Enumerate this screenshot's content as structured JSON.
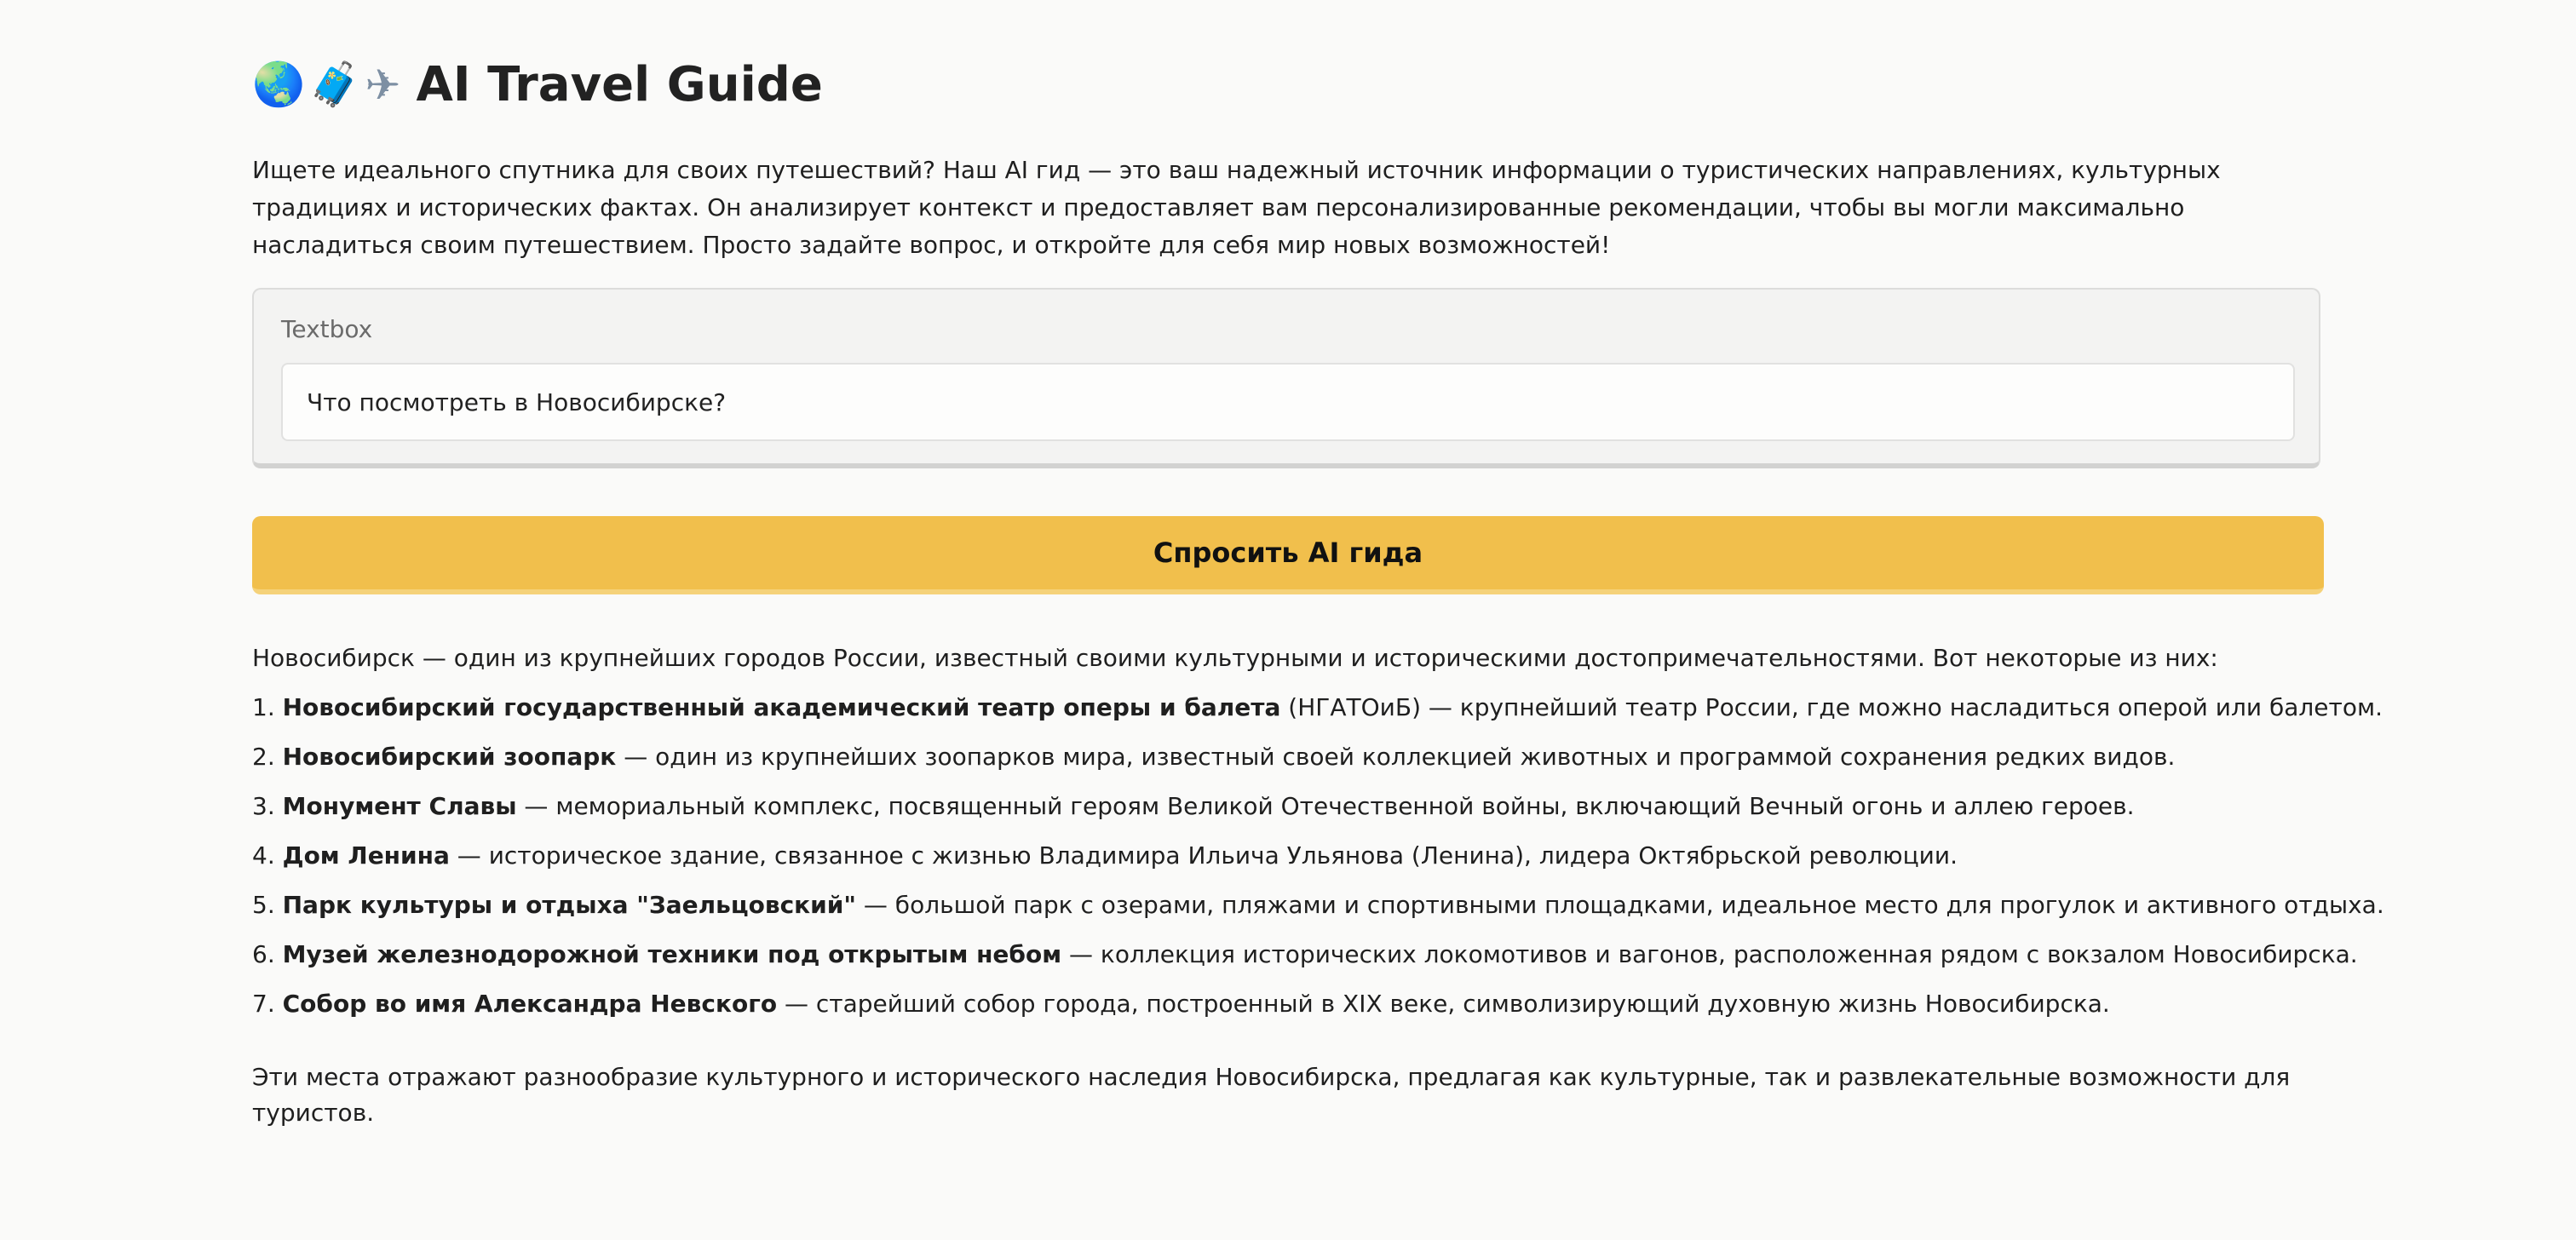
{
  "header": {
    "emoji_globe": "🌏",
    "emoji_luggage": "🧳",
    "emoji_plane": "✈",
    "title": "AI Travel Guide"
  },
  "intro": "Ищете идеального спутника для своих путешествий? Наш AI гид — это ваш надежный источник информации о туристических направлениях, культурных традициях и исторических фактах. Он анализирует контекст и предоставляет вам персонализированные рекомендации, чтобы вы могли максимально насладиться своим путешествием. Просто задайте вопрос, и откройте для себя мир новых возможностей!",
  "textbox": {
    "label": "Textbox",
    "value": "Что посмотреть в Новосибирске?"
  },
  "ask_button": {
    "label": "Спросить AI гида",
    "color": "#f1bf4c"
  },
  "answer": {
    "lead": "Новосибирск — один из крупнейших городов России, известный своими культурными и историческими достопримечательностями. Вот некоторые из них:",
    "items": [
      {
        "num": "1.",
        "name": "Новосибирский государственный академический театр оперы и балета",
        "desc": " (НГАТОиБ) — крупнейший театр России, где можно насладиться оперой или балетом."
      },
      {
        "num": "2.",
        "name": "Новосибирский зоопарк",
        "desc": " — один из крупнейших зоопарков мира, известный своей коллекцией животных и программой сохранения редких видов."
      },
      {
        "num": "3.",
        "name": "Монумент Славы",
        "desc": " — мемориальный комплекс, посвященный героям Великой Отечественной войны, включающий Вечный огонь и аллею героев."
      },
      {
        "num": "4.",
        "name": "Дом Ленина",
        "desc": " — историческое здание, связанное с жизнью Владимира Ильича Ульянова (Ленина), лидера Октябрьской революции."
      },
      {
        "num": "5.",
        "name": "Парк культуры и отдыха \"Заельцовский\"",
        "desc": " — большой парк с озерами, пляжами и спортивными площадками, идеальное место для прогулок и активного отдыха."
      },
      {
        "num": "6.",
        "name": "Музей железнодорожной техники под открытым небом",
        "desc": " — коллекция исторических локомотивов и вагонов, расположенная рядом с вокзалом Новосибирска."
      },
      {
        "num": "7.",
        "name": "Собор во имя Александра Невского",
        "desc": " — старейший собор города, построенный в XIX веке, символизирующий духовную жизнь Новосибирска."
      }
    ],
    "outro": "Эти места отражают разнообразие культурного и исторического наследия Новосибирска, предлагая как культурные, так и развлекательные возможности для туристов."
  }
}
